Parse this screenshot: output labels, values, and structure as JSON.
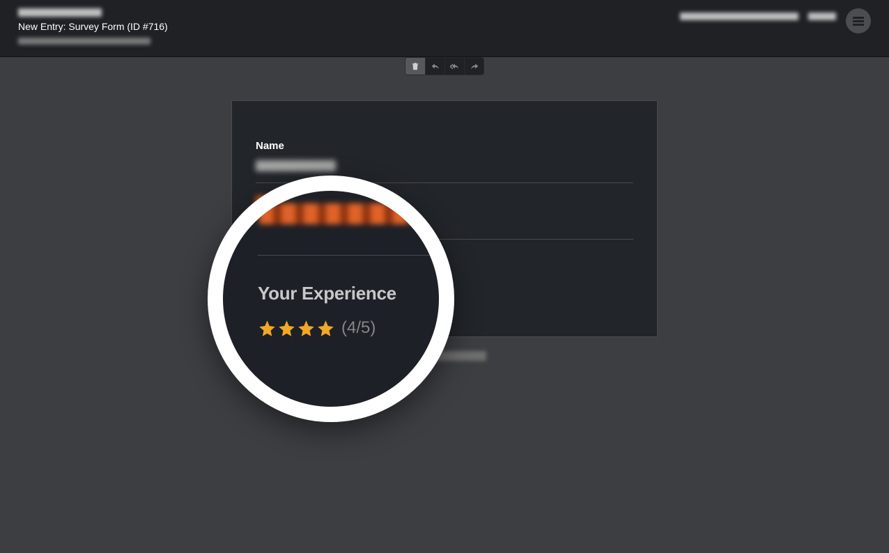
{
  "header": {
    "subtitle": "New Entry: Survey Form (ID #716)"
  },
  "card": {
    "name_label": "Name"
  },
  "lens": {
    "heading": "Your Experience",
    "rating_text": "(4/5)",
    "filled_stars": 4,
    "total_stars": 5,
    "star_color": "#f2a728"
  }
}
